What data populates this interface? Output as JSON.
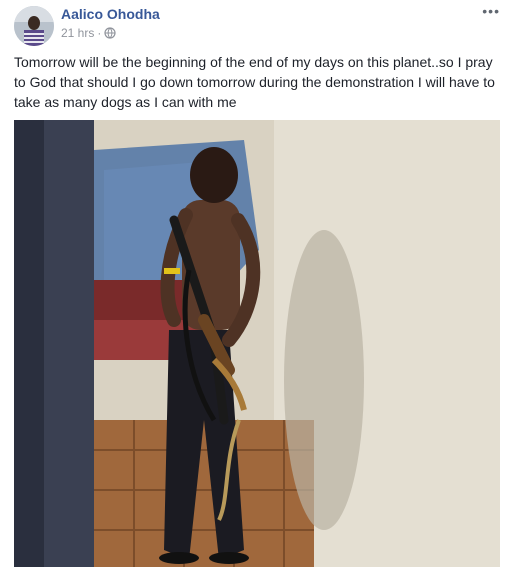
{
  "post": {
    "author": "Aalico Ohodha",
    "timestamp": "21 hrs",
    "separator": "·",
    "privacy_icon": "globe-icon",
    "more_label": "•••",
    "text": "Tomorrow will be the beginning of the end of my days on this planet..so I pray to God that should I go down tomorrow during the demonstration I will have to take as many dogs as I can with me"
  },
  "colors": {
    "author_link": "#385898",
    "meta_gray": "#90949c",
    "body_text": "#1d2129"
  }
}
